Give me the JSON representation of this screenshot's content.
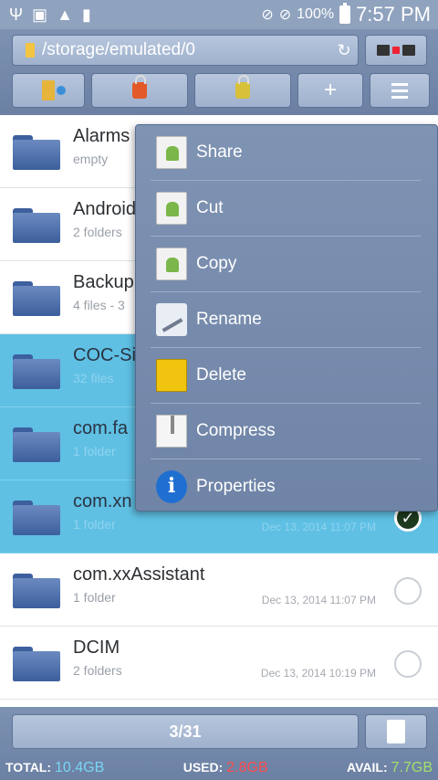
{
  "status_bar": {
    "battery_percent": "100%",
    "time": "7:57 PM"
  },
  "toolbar": {
    "path": "/storage/emulated/0",
    "add_label": "+"
  },
  "files": [
    {
      "name": "Alarms",
      "info": "empty",
      "date": "",
      "selected": false
    },
    {
      "name": "Android",
      "info": "2 folders",
      "date": "",
      "selected": false
    },
    {
      "name": "Backup",
      "info": "4 files - 3",
      "date": "",
      "selected": false
    },
    {
      "name": "COC-Si",
      "info": "32 files",
      "date": "",
      "selected": true
    },
    {
      "name": "com.fa",
      "info": "1 folder",
      "date": "",
      "selected": true
    },
    {
      "name": "com.xn",
      "info": "1 folder",
      "date": "Dec 13, 2014 11:07 PM",
      "selected": true
    },
    {
      "name": "com.xxAssistant",
      "info": "1 folder",
      "date": "Dec 13, 2014 11:07 PM",
      "selected": false
    },
    {
      "name": "DCIM",
      "info": "2 folders",
      "date": "Dec 13, 2014 10:19 PM",
      "selected": false
    }
  ],
  "context_menu": {
    "items": [
      {
        "label": "Share",
        "icon": "share-icon"
      },
      {
        "label": "Cut",
        "icon": "cut-icon"
      },
      {
        "label": "Copy",
        "icon": "copy-icon"
      },
      {
        "label": "Rename",
        "icon": "rename-icon"
      },
      {
        "label": "Delete",
        "icon": "delete-icon"
      },
      {
        "label": "Compress",
        "icon": "compress-icon"
      },
      {
        "label": "Properties",
        "icon": "properties-icon"
      }
    ]
  },
  "bottom_bar": {
    "page_indicator": "3/31",
    "total_label": "TOTAL:",
    "total_value": "10.4GB",
    "used_label": "USED:",
    "used_value": "2.8GB",
    "avail_label": "AVAIL:",
    "avail_value": "7.7GB"
  },
  "colors": {
    "accent_selected": "#5fc0e4",
    "toolbar": "#7d92b2",
    "total": "#7ad6f5",
    "used": "#ff4b4b",
    "avail": "#a2e06b"
  }
}
